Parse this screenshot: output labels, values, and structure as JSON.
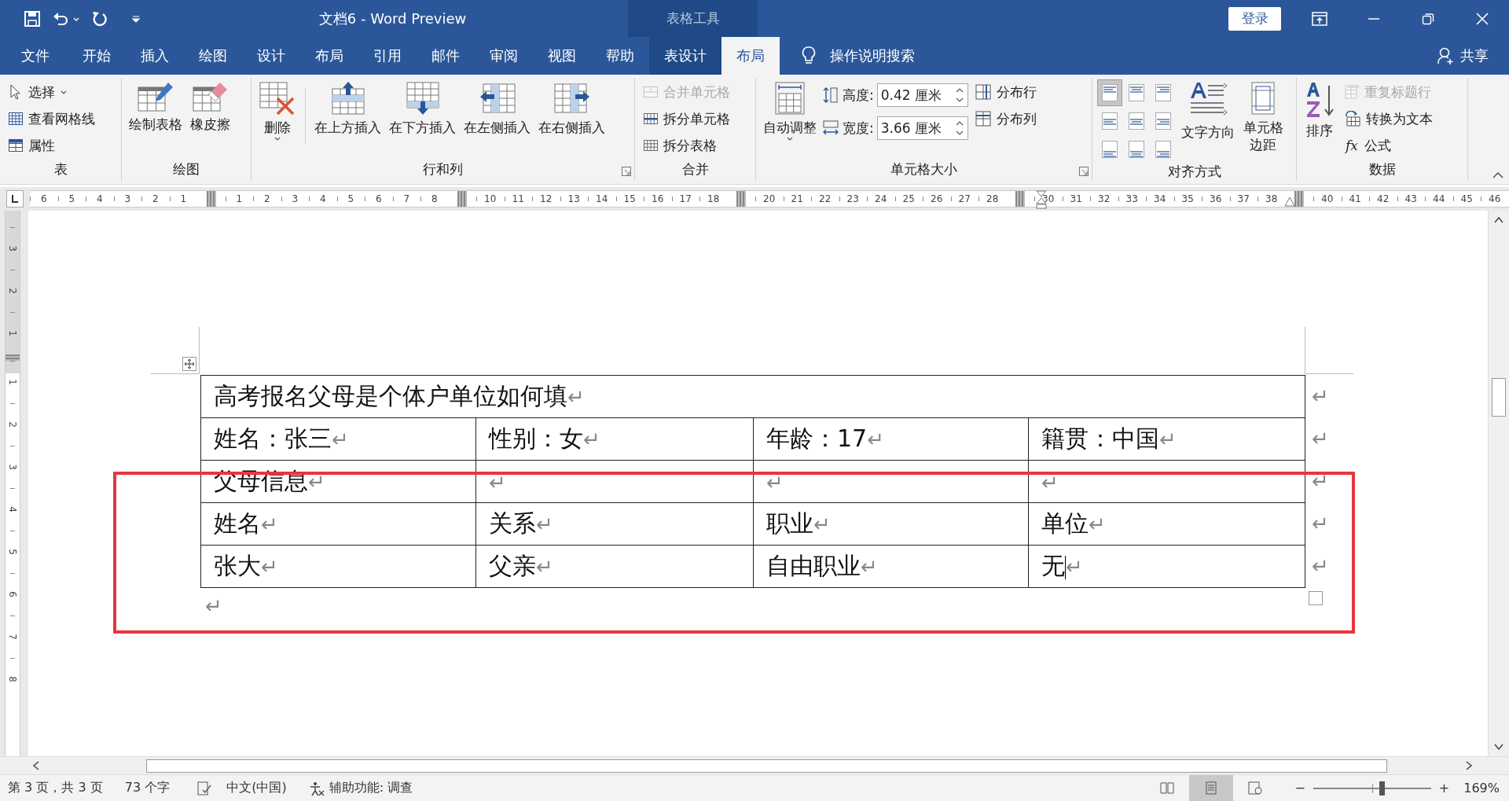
{
  "window": {
    "title": "文档6  -  Word Preview",
    "context_header": "表格工具",
    "sign_in": "登录"
  },
  "tabs": [
    {
      "label": "文件",
      "selected": false,
      "contextual": false
    },
    {
      "label": "开始",
      "selected": false,
      "contextual": false
    },
    {
      "label": "插入",
      "selected": false,
      "contextual": false
    },
    {
      "label": "绘图",
      "selected": false,
      "contextual": false
    },
    {
      "label": "设计",
      "selected": false,
      "contextual": false
    },
    {
      "label": "布局",
      "selected": false,
      "contextual": false
    },
    {
      "label": "引用",
      "selected": false,
      "contextual": false
    },
    {
      "label": "邮件",
      "selected": false,
      "contextual": false
    },
    {
      "label": "审阅",
      "selected": false,
      "contextual": false
    },
    {
      "label": "视图",
      "selected": false,
      "contextual": false
    },
    {
      "label": "帮助",
      "selected": false,
      "contextual": false
    },
    {
      "label": "表设计",
      "selected": false,
      "contextual": true
    },
    {
      "label": "布局",
      "selected": true,
      "contextual": true
    }
  ],
  "tell_me": {
    "label": "操作说明搜索"
  },
  "share": {
    "label": "共享"
  },
  "ribbon": {
    "groups": [
      {
        "label": "表",
        "launcher": false,
        "items": [
          {
            "kind": "small",
            "label": "选择",
            "dropdown": true,
            "disabled": false
          },
          {
            "kind": "small",
            "label": "查看网格线",
            "dropdown": false,
            "disabled": false
          },
          {
            "kind": "small",
            "label": "属性",
            "dropdown": false,
            "disabled": false
          }
        ]
      },
      {
        "label": "绘图",
        "launcher": false,
        "items": [
          {
            "kind": "large",
            "label": "绘制表格",
            "dropdown": false,
            "disabled": false
          },
          {
            "kind": "large",
            "label": "橡皮擦",
            "dropdown": false,
            "disabled": false
          }
        ]
      },
      {
        "label": "行和列",
        "launcher": true,
        "items": [
          {
            "kind": "large",
            "label": "删除",
            "dropdown": true,
            "disabled": false
          },
          {
            "kind": "separator"
          },
          {
            "kind": "large",
            "label": "在上方插入",
            "dropdown": false,
            "disabled": false
          },
          {
            "kind": "large",
            "label": "在下方插入",
            "dropdown": false,
            "disabled": false
          },
          {
            "kind": "large",
            "label": "在左侧插入",
            "dropdown": false,
            "disabled": false
          },
          {
            "kind": "large",
            "label": "在右侧插入",
            "dropdown": false,
            "disabled": false
          }
        ]
      },
      {
        "label": "合并",
        "launcher": false,
        "items": [
          {
            "kind": "small",
            "label": "合并单元格",
            "dropdown": false,
            "disabled": true
          },
          {
            "kind": "small",
            "label": "拆分单元格",
            "dropdown": false,
            "disabled": false
          },
          {
            "kind": "small",
            "label": "拆分表格",
            "dropdown": false,
            "disabled": false
          }
        ]
      },
      {
        "label": "单元格大小",
        "launcher": true,
        "items": [
          {
            "kind": "large",
            "label": "自动调整",
            "dropdown": true,
            "disabled": false
          },
          {
            "kind": "spin",
            "label": "高度:",
            "value": "0.42 厘米",
            "disabled": false
          },
          {
            "kind": "spin",
            "label": "宽度:",
            "value": "3.66 厘米",
            "disabled": false
          },
          {
            "kind": "small",
            "label": "分布行",
            "dropdown": false,
            "disabled": false
          },
          {
            "kind": "small",
            "label": "分布列",
            "dropdown": false,
            "disabled": false
          }
        ]
      },
      {
        "label": "对齐方式",
        "launcher": false,
        "items": [
          {
            "kind": "align",
            "cells": [
              {
                "selected": true
              },
              {
                "selected": false
              },
              {
                "selected": false
              },
              {
                "selected": false
              },
              {
                "selected": false
              },
              {
                "selected": false
              },
              {
                "selected": false
              },
              {
                "selected": false
              },
              {
                "selected": false
              }
            ]
          },
          {
            "kind": "large",
            "label": "文字方向",
            "dropdown": false,
            "disabled": false
          },
          {
            "kind": "large",
            "label": "单元格边距",
            "dropdown": false,
            "disabled": false
          }
        ]
      },
      {
        "label": "数据",
        "launcher": false,
        "items": [
          {
            "kind": "large",
            "label": "排序",
            "dropdown": false,
            "disabled": false
          },
          {
            "kind": "small",
            "label": "重复标题行",
            "dropdown": false,
            "disabled": true
          },
          {
            "kind": "small",
            "label": "转换为文本",
            "dropdown": false,
            "disabled": false
          },
          {
            "kind": "small",
            "label": "公式",
            "icon_text": "fx",
            "dropdown": false,
            "disabled": false
          }
        ]
      }
    ]
  },
  "ruler": {
    "marks": [
      {
        "kind": "num",
        "text": "6"
      },
      {
        "kind": "num",
        "text": "5"
      },
      {
        "kind": "num",
        "text": "4"
      },
      {
        "kind": "num",
        "text": "3"
      },
      {
        "kind": "num",
        "text": "2"
      },
      {
        "kind": "num",
        "text": "1"
      },
      {
        "kind": "margin"
      },
      {
        "kind": "num",
        "text": "1"
      },
      {
        "kind": "num",
        "text": "2"
      },
      {
        "kind": "num",
        "text": "3"
      },
      {
        "kind": "num",
        "text": "4"
      },
      {
        "kind": "num",
        "text": "5"
      },
      {
        "kind": "num",
        "text": "6"
      },
      {
        "kind": "num",
        "text": "7"
      },
      {
        "kind": "num",
        "text": "8"
      },
      {
        "kind": "margin"
      },
      {
        "kind": "num",
        "text": "10"
      },
      {
        "kind": "num",
        "text": "11"
      },
      {
        "kind": "num",
        "text": "12"
      },
      {
        "kind": "num",
        "text": "13"
      },
      {
        "kind": "num",
        "text": "14"
      },
      {
        "kind": "num",
        "text": "15"
      },
      {
        "kind": "num",
        "text": "16"
      },
      {
        "kind": "num",
        "text": "17"
      },
      {
        "kind": "num",
        "text": "18"
      },
      {
        "kind": "margin"
      },
      {
        "kind": "num",
        "text": "20"
      },
      {
        "kind": "num",
        "text": "21"
      },
      {
        "kind": "num",
        "text": "22"
      },
      {
        "kind": "num",
        "text": "23"
      },
      {
        "kind": "num",
        "text": "24"
      },
      {
        "kind": "num",
        "text": "25"
      },
      {
        "kind": "num",
        "text": "26"
      },
      {
        "kind": "num",
        "text": "27"
      },
      {
        "kind": "num",
        "text": "28"
      },
      {
        "kind": "margin"
      },
      {
        "kind": "num",
        "text": "30"
      },
      {
        "kind": "num",
        "text": "31"
      },
      {
        "kind": "num",
        "text": "32"
      },
      {
        "kind": "num",
        "text": "33"
      },
      {
        "kind": "num",
        "text": "34"
      },
      {
        "kind": "num",
        "text": "35"
      },
      {
        "kind": "num",
        "text": "36"
      },
      {
        "kind": "num",
        "text": "37"
      },
      {
        "kind": "num",
        "text": "38"
      },
      {
        "kind": "margin"
      },
      {
        "kind": "num",
        "text": "40"
      },
      {
        "kind": "num",
        "text": "41"
      },
      {
        "kind": "num",
        "text": "42"
      },
      {
        "kind": "num",
        "text": "43"
      },
      {
        "kind": "num",
        "text": "44"
      },
      {
        "kind": "num",
        "text": "45"
      },
      {
        "kind": "num",
        "text": "46"
      }
    ]
  },
  "vertical_ruler": {
    "marks": [
      {
        "kind": "num",
        "text": "3"
      },
      {
        "kind": "num",
        "text": "2"
      },
      {
        "kind": "num",
        "text": "1"
      },
      {
        "kind": "margin"
      },
      {
        "kind": "num",
        "text": "1"
      },
      {
        "kind": "num",
        "text": "2"
      },
      {
        "kind": "num",
        "text": "3"
      },
      {
        "kind": "num",
        "text": "4"
      },
      {
        "kind": "num",
        "text": "5"
      },
      {
        "kind": "num",
        "text": "6"
      },
      {
        "kind": "num",
        "text": "7"
      },
      {
        "kind": "num",
        "text": "8"
      }
    ]
  },
  "document": {
    "rows": [
      {
        "cells": [
          {
            "text": "高考报名父母是个体户单位如何填",
            "mark": "↵",
            "cursor": false,
            "colspan": 4
          }
        ],
        "end_mark": "↵"
      },
      {
        "cells": [
          {
            "text": "姓名：张三",
            "mark": "↵",
            "cursor": false
          },
          {
            "text": "性别：女",
            "mark": "↵",
            "cursor": false
          },
          {
            "text": "年龄：17",
            "mark": "↵",
            "cursor": false
          },
          {
            "text": "籍贯：中国",
            "mark": "↵",
            "cursor": false
          }
        ],
        "end_mark": "↵"
      },
      {
        "cells": [
          {
            "text": "父母信息",
            "mark": "↵",
            "cursor": false
          },
          {
            "mark": "↵",
            "cursor": false
          },
          {
            "mark": "↵",
            "cursor": false
          },
          {
            "mark": "↵",
            "cursor": false
          }
        ],
        "end_mark": "↵"
      },
      {
        "cells": [
          {
            "text": "姓名",
            "mark": "↵",
            "cursor": false
          },
          {
            "text": "关系",
            "mark": "↵",
            "cursor": false
          },
          {
            "text": "职业",
            "mark": "↵",
            "cursor": false
          },
          {
            "text": "单位",
            "mark": "↵",
            "cursor": false
          }
        ],
        "end_mark": "↵"
      },
      {
        "cells": [
          {
            "text": "张大",
            "mark": "↵",
            "cursor": false
          },
          {
            "text": "父亲",
            "mark": "↵",
            "cursor": false
          },
          {
            "text": "自由职业",
            "mark": "↵",
            "cursor": false
          },
          {
            "text": "无",
            "mark": "↵",
            "cursor": true
          }
        ],
        "end_mark": "↵"
      }
    ],
    "after_mark": "↵"
  },
  "status_bar": {
    "page": "第 3 页，共 3 页",
    "words": "73 个字",
    "language": "中文(中国)",
    "accessibility": "辅助功能: 调查",
    "views": [
      {
        "selected": false
      },
      {
        "selected": true
      },
      {
        "selected": false
      }
    ],
    "zoom": {
      "minus": "−",
      "plus": "+",
      "level": 0.58,
      "text": "169%"
    }
  }
}
